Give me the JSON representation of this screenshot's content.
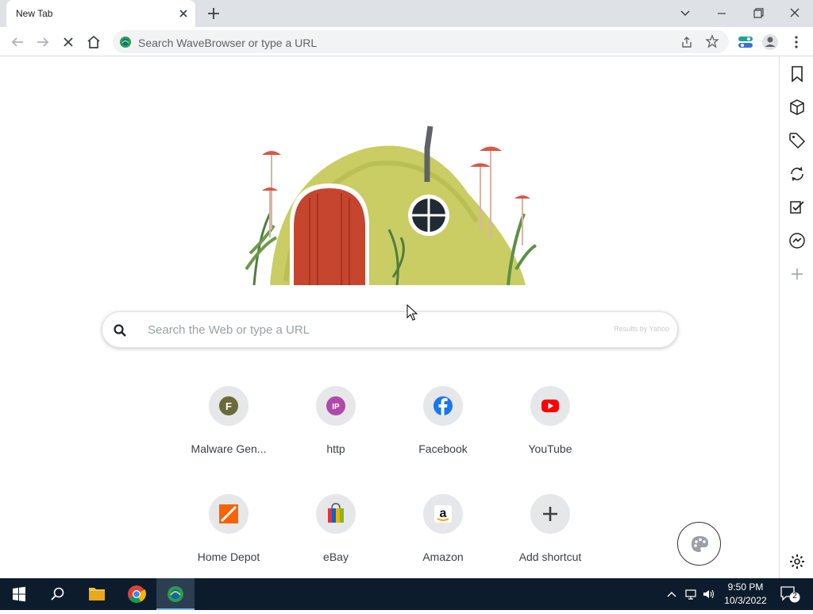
{
  "browser": {
    "tab_title": "New Tab",
    "omnibox_placeholder": "Search WaveBrowser or type a URL"
  },
  "search": {
    "placeholder": "Search the Web or type a URL",
    "credit": "Results by Yahoo"
  },
  "shortcuts": [
    {
      "label": "Malware Gen...",
      "icon_name": "letter-f-icon",
      "glyph": "F",
      "color": "#6b6a3a"
    },
    {
      "label": "http",
      "icon_name": "ip-icon",
      "glyph": "IP",
      "color": "#b04aa8"
    },
    {
      "label": "Facebook",
      "icon_name": "facebook-icon",
      "color": "#1877f2"
    },
    {
      "label": "YouTube",
      "icon_name": "youtube-icon",
      "color": "#ff0000"
    },
    {
      "label": "Home Depot",
      "icon_name": "home-depot-icon",
      "color": "#f96302"
    },
    {
      "label": "eBay",
      "icon_name": "ebay-bag-icon"
    },
    {
      "label": "Amazon",
      "icon_name": "amazon-icon"
    },
    {
      "label": "Add shortcut",
      "icon_name": "plus-icon"
    }
  ],
  "sidebar_icons": [
    "bookmark-icon",
    "box-icon",
    "tag-icon",
    "sync-icon",
    "checklist-icon",
    "messenger-icon",
    "plus-icon",
    "gear-icon"
  ],
  "taskbar": {
    "time": "9:50 PM",
    "date": "10/3/2022",
    "notification_count": "2"
  },
  "colors": {
    "accent": "#1a73e8",
    "taskbar_bg": "#0d1c2c"
  }
}
